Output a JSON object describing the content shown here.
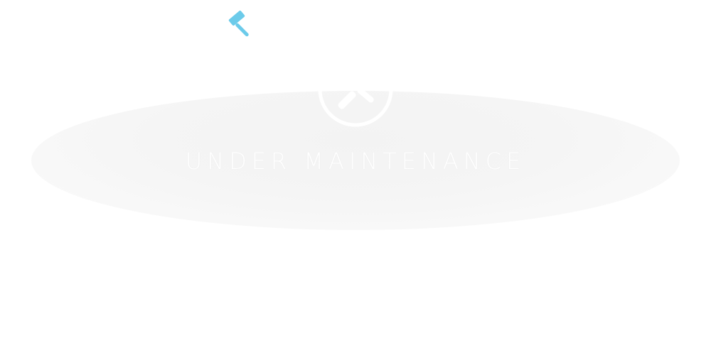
{
  "maintenance": {
    "title": "UNDER MAINTENANCE",
    "icon": "gavel-icon",
    "badge_icon": "tools-badge-icon"
  },
  "colors": {
    "accent": "#6ccbea",
    "background": "#ffffff",
    "oval": "#f5f5f5",
    "title_text": "#ffffff"
  }
}
